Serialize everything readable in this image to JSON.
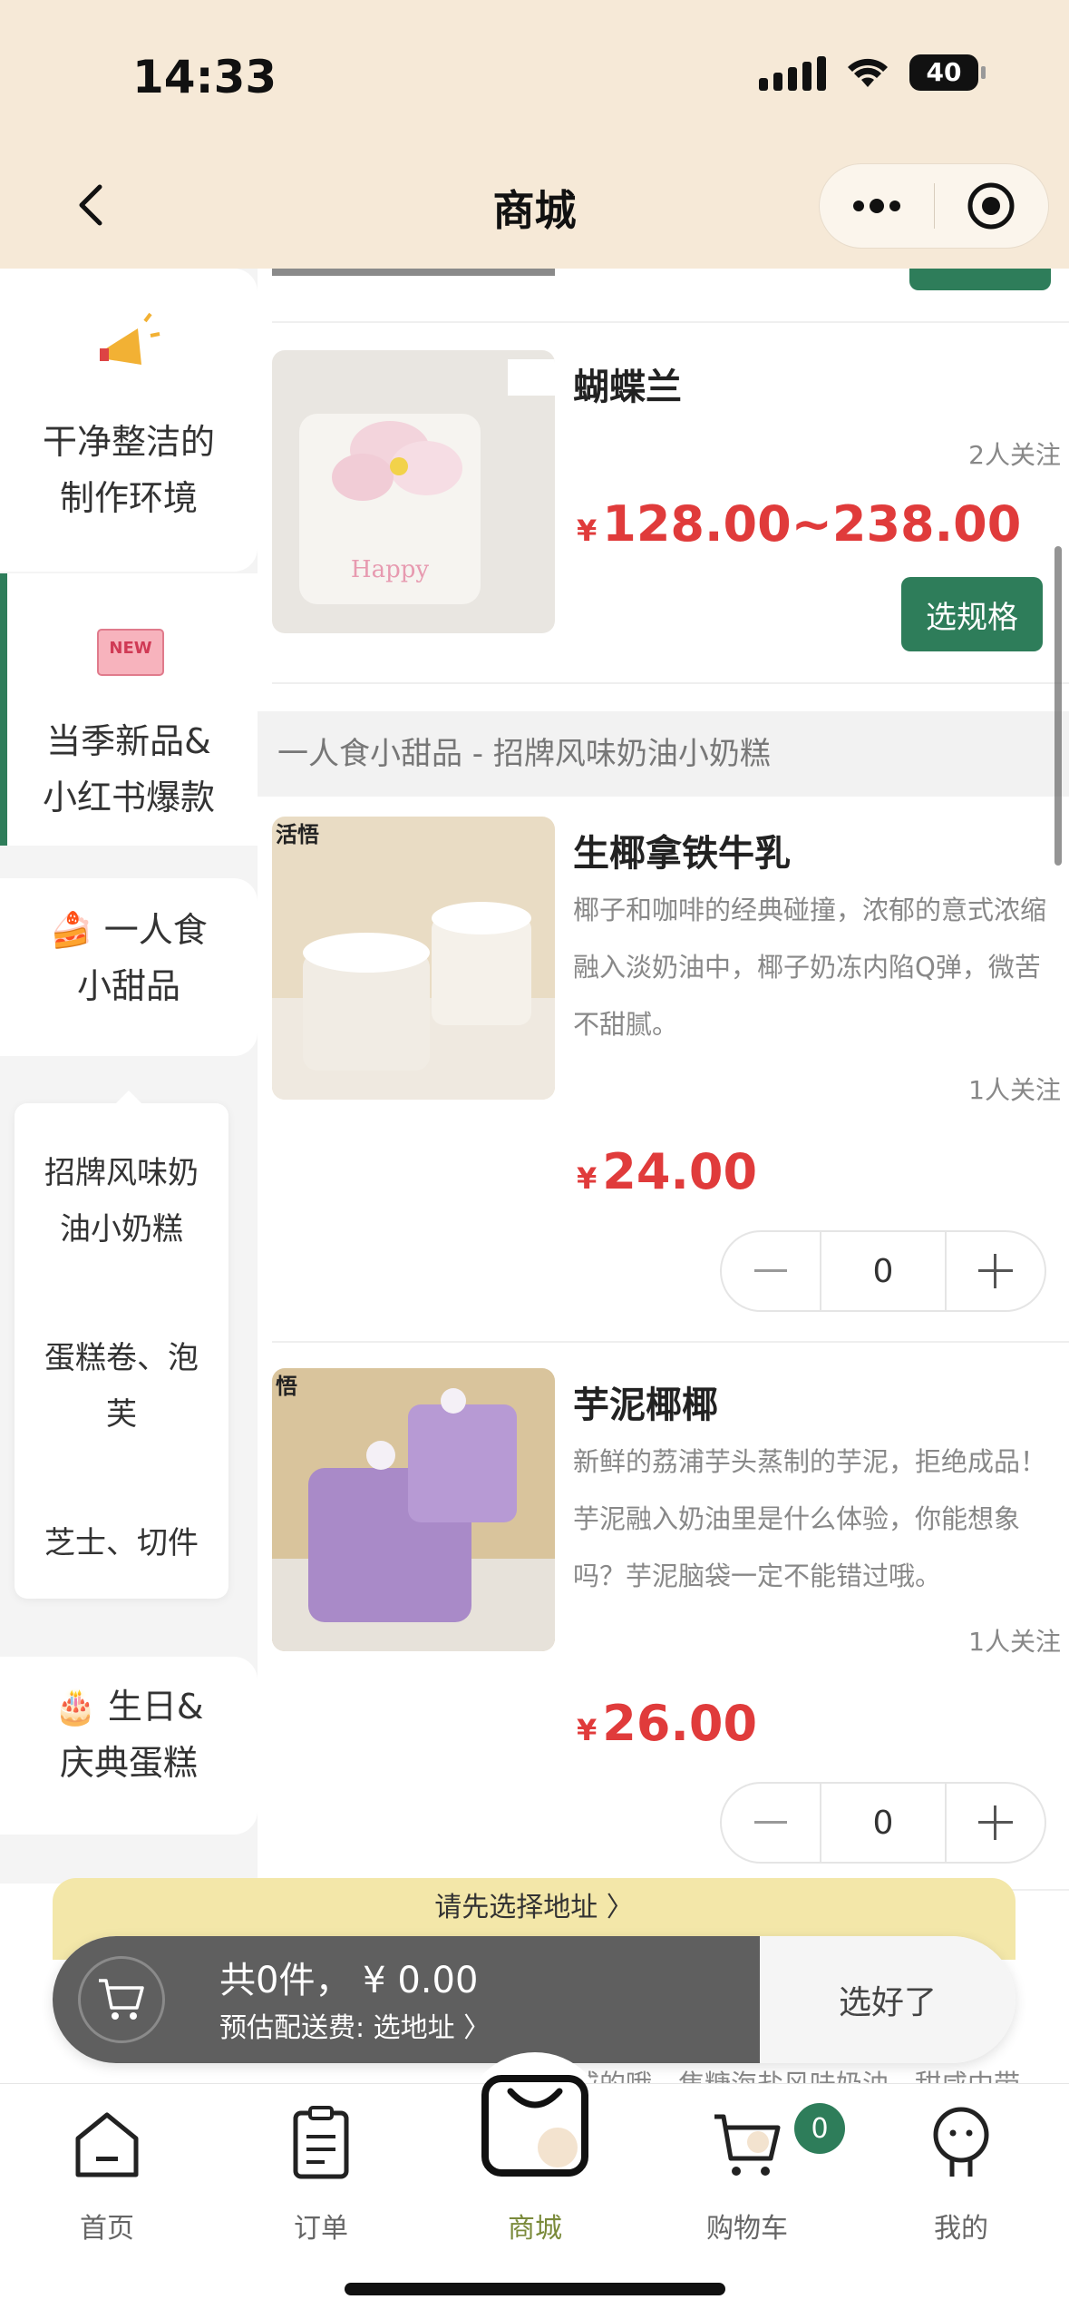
{
  "status": {
    "time": "14:33",
    "battery": "40"
  },
  "nav": {
    "title": "商城"
  },
  "sidebar": {
    "categories": [
      {
        "label": "干净整洁的制作环境",
        "line1": "干净整洁的",
        "line2": "制作环境",
        "icon": "megaphone-icon"
      },
      {
        "label": "当季新品&小红书爆款",
        "line1": "当季新品&",
        "line2": "小红书爆款",
        "icon": "new-badge-icon"
      },
      {
        "label": "一人食小甜品",
        "line1": "🍰 一人食",
        "line2": "小甜品",
        "icon": "cake-slice-icon"
      },
      {
        "label": "生日&庆典蛋糕",
        "line1": "🎂 生日&",
        "line2": "庆典蛋糕",
        "icon": "birthday-cake-icon"
      }
    ],
    "subcategories": [
      {
        "line1": "招牌风味奶",
        "line2": "油小奶糕"
      },
      {
        "line1": "蛋糕卷、泡",
        "line2": "芙"
      },
      {
        "line1": "芝士、切件",
        "line2": ""
      }
    ]
  },
  "main": {
    "top_button_label": "选规格",
    "section_title": "一人食小甜品 - 招牌风味奶油小奶糕",
    "products": [
      {
        "name": "蝴蝶兰",
        "followers": "2人关注",
        "currency": "¥",
        "price": "128.00~238.00",
        "button": "选规格",
        "desc": ""
      },
      {
        "name": "生椰拿铁牛乳",
        "followers": "1人关注",
        "currency": "¥",
        "price": "24.00",
        "qty": "0",
        "desc": "椰子和咖啡的经典碰撞，浓郁的意式浓缩融入淡奶油中，椰子奶冻内陷Q弹，微苦不甜腻。"
      },
      {
        "name": "芋泥椰椰",
        "followers": "1人关注",
        "currency": "¥",
        "price": "26.00",
        "qty": "0",
        "desc": "新鲜的荔浦芋头蒸制的芋泥，拒绝成品！芋泥融入奶油里是什么体验，你能想象吗？芋泥脑袋一定不能错过哦。"
      }
    ],
    "partial_desc": "咸的哦。焦糖海盐风味奶油，甜咸中带"
  },
  "cart": {
    "address_prompt": "请先选择地址 〉",
    "total": "共0件，  ¥ 0.00",
    "fee": "预估配送费: 选地址 〉",
    "checkout": "选好了"
  },
  "tabbar": {
    "items": [
      {
        "label": "首页",
        "icon": "home-icon"
      },
      {
        "label": "订单",
        "icon": "order-list-icon"
      },
      {
        "label": "商城",
        "icon": "shopping-bag-icon"
      },
      {
        "label": "购物车",
        "icon": "cart-icon"
      },
      {
        "label": "我的",
        "icon": "profile-icon"
      }
    ],
    "cart_badge": "0"
  },
  "colors": {
    "accent_green": "#2e7d5a",
    "price_red": "#e03b3b",
    "header_bg": "#f6e9d7",
    "active_tab": "#7a8a3a"
  }
}
